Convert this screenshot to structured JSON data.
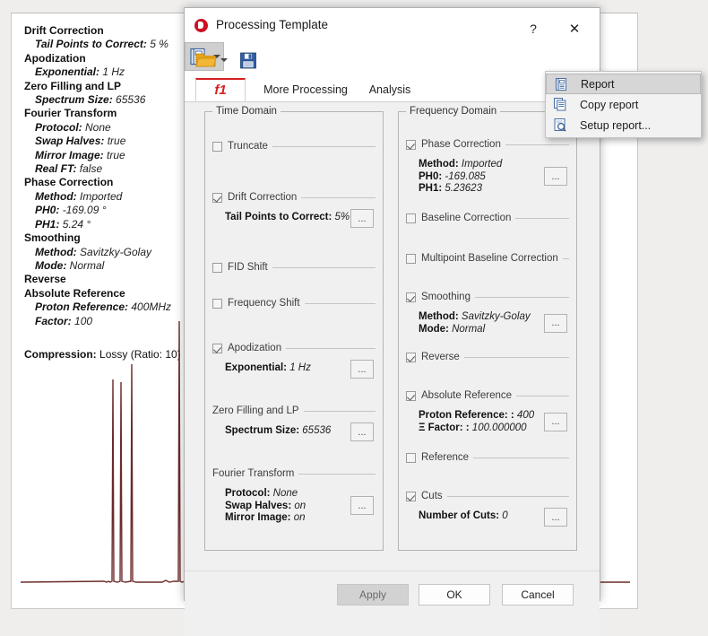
{
  "background": {
    "params": [
      {
        "type": "header",
        "label": "Drift Correction"
      },
      {
        "type": "sub",
        "key": "Tail Points to Correct:",
        "value": "5 %"
      },
      {
        "type": "header",
        "label": "Apodization"
      },
      {
        "type": "sub",
        "key": "Exponential:",
        "value": "1 Hz"
      },
      {
        "type": "header",
        "label": "Zero Filling and LP"
      },
      {
        "type": "sub",
        "key": "Spectrum Size:",
        "value": "65536"
      },
      {
        "type": "header",
        "label": "Fourier Transform"
      },
      {
        "type": "sub",
        "key": "Protocol:",
        "value": "None"
      },
      {
        "type": "sub",
        "key": "Swap Halves:",
        "value": "true"
      },
      {
        "type": "sub",
        "key": "Mirror Image:",
        "value": "true"
      },
      {
        "type": "sub",
        "key": "Real FT:",
        "value": "false"
      },
      {
        "type": "header",
        "label": "Phase Correction"
      },
      {
        "type": "sub",
        "key": "Method:",
        "value": "Imported"
      },
      {
        "type": "sub",
        "key": "PH0:",
        "value": "-169.09 °"
      },
      {
        "type": "sub",
        "key": "PH1:",
        "value": "5.24 °"
      },
      {
        "type": "header",
        "label": "Smoothing"
      },
      {
        "type": "sub",
        "key": "Method:",
        "value": "Savitzky-Golay"
      },
      {
        "type": "sub",
        "key": "Mode:",
        "value": "Normal"
      },
      {
        "type": "header",
        "label": "Reverse"
      },
      {
        "type": "header",
        "label": "Absolute Reference"
      },
      {
        "type": "sub",
        "key": "Proton Reference:",
        "value": "400MHz"
      },
      {
        "type": "sub",
        "key": "Factor:",
        "value": "100"
      }
    ],
    "compression_label": "Compression:",
    "compression_value": "Lossy (Ratio: 10)",
    "spectrum_color": "#6b2b2b"
  },
  "dialog": {
    "title": "Processing Template",
    "help_label": "?",
    "close_label": "✕",
    "toolbar": {
      "open_name": "open-template-icon",
      "save_name": "save-template-icon",
      "report_name": "report-icon"
    },
    "tabs": [
      {
        "label": "f1",
        "active": true
      },
      {
        "label": "More Processing",
        "active": false
      },
      {
        "label": "Analysis",
        "active": false
      }
    ],
    "time_domain": {
      "title": "Time Domain",
      "sections": [
        {
          "label": "Truncate",
          "checked": false,
          "rows": [],
          "has_button": false
        },
        {
          "label": "Drift Correction",
          "checked": true,
          "rows": [
            {
              "key": "Tail Points to Correct:",
              "value": "5%"
            }
          ],
          "has_button": true
        },
        {
          "label": "FID Shift",
          "checked": false,
          "rows": [],
          "has_button": false
        },
        {
          "label": "Frequency Shift",
          "checked": false,
          "rows": [],
          "has_button": false
        },
        {
          "label": "Apodization",
          "checked": true,
          "rows": [
            {
              "key": "Exponential:",
              "value": "1 Hz"
            }
          ],
          "has_button": true
        },
        {
          "label": "Zero Filling and LP",
          "checked": null,
          "rows": [
            {
              "key": "Spectrum Size:",
              "value": "65536"
            }
          ],
          "has_button": true
        },
        {
          "label": "Fourier Transform",
          "checked": null,
          "rows": [
            {
              "key": "Protocol:",
              "value": "None"
            },
            {
              "key": "Swap Halves:",
              "value": "on"
            },
            {
              "key": "Mirror Image:",
              "value": "on"
            }
          ],
          "has_button": true
        }
      ]
    },
    "frequency_domain": {
      "title": "Frequency Domain",
      "sections": [
        {
          "label": "Phase Correction",
          "checked": true,
          "rows": [
            {
              "key": "Method:",
              "value": "Imported"
            },
            {
              "key": "PH0:",
              "value": "-169.085"
            },
            {
              "key": "PH1:",
              "value": "5.23623"
            }
          ],
          "has_button": true
        },
        {
          "label": "Baseline Correction",
          "checked": false,
          "rows": [],
          "has_button": false
        },
        {
          "label": "Multipoint Baseline Correction",
          "checked": false,
          "rows": [],
          "has_button": false
        },
        {
          "label": "Smoothing",
          "checked": true,
          "rows": [
            {
              "key": "Method:",
              "value": "Savitzky-Golay"
            },
            {
              "key": "Mode:",
              "value": "Normal"
            }
          ],
          "has_button": true
        },
        {
          "label": "Reverse",
          "checked": true,
          "rows": [],
          "has_button": false
        },
        {
          "label": "Absolute Reference",
          "checked": true,
          "rows": [
            {
              "key": "Proton Reference: :",
              "value": "400"
            },
            {
              "key": "Ξ Factor: :",
              "value": "100.000000"
            }
          ],
          "has_button": true
        },
        {
          "label": "Reference",
          "checked": false,
          "rows": [],
          "has_button": false
        },
        {
          "label": "Cuts",
          "checked": true,
          "rows": [
            {
              "key": "Number of Cuts:",
              "value": "0"
            }
          ],
          "has_button": true
        }
      ]
    },
    "footer": {
      "apply_label": "Apply",
      "ok_label": "OK",
      "cancel_label": "Cancel"
    }
  },
  "report_menu": {
    "items": [
      {
        "label": "Report",
        "icon": "report-page-icon",
        "highlighted": true
      },
      {
        "label": "Copy report",
        "icon": "copy-report-icon",
        "highlighted": false
      },
      {
        "label": "Setup report...",
        "icon": "setup-report-icon",
        "highlighted": false
      }
    ]
  }
}
